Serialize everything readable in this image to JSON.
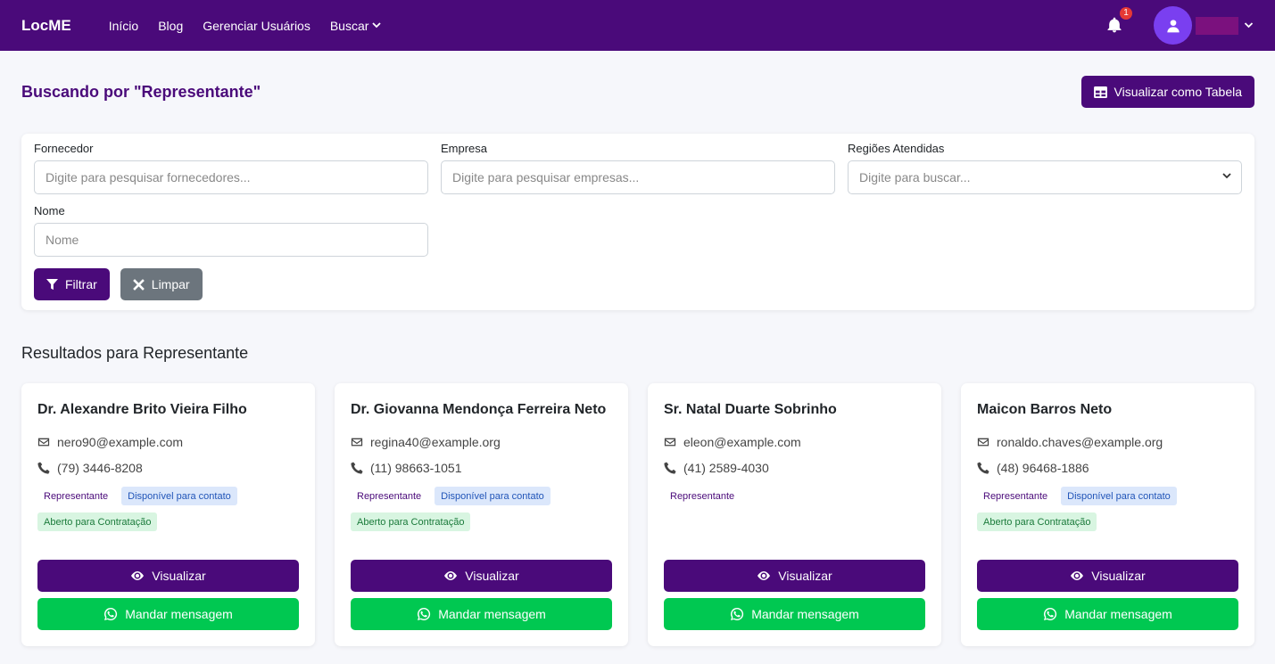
{
  "nav": {
    "brand": "LocME",
    "links": [
      "Início",
      "Blog",
      "Gerenciar Usuários",
      "Buscar"
    ],
    "notification_count": "1"
  },
  "header": {
    "title": "Buscando por \"Representante\"",
    "table_button": "Visualizar como Tabela"
  },
  "filters": {
    "fornecedor": {
      "label": "Fornecedor",
      "placeholder": "Digite para pesquisar fornecedores..."
    },
    "empresa": {
      "label": "Empresa",
      "placeholder": "Digite para pesquisar empresas..."
    },
    "regioes": {
      "label": "Regiões Atendidas",
      "placeholder": "Digite para buscar..."
    },
    "nome": {
      "label": "Nome",
      "placeholder": "Nome"
    },
    "filter_button": "Filtrar",
    "clear_button": "Limpar"
  },
  "results": {
    "title": "Resultados para Representante",
    "view_label": "Visualizar",
    "message_label": "Mandar mensagem",
    "cards": [
      {
        "name": "Dr. Alexandre Brito Vieira Filho",
        "email": "nero90@example.com",
        "phone": "(79) 3446-8208",
        "badges": [
          "Representante",
          "Disponível para contato",
          "Aberto para Contratação"
        ]
      },
      {
        "name": "Dr. Giovanna Mendonça Ferreira Neto",
        "email": "regina40@example.org",
        "phone": "(11) 98663-1051",
        "badges": [
          "Representante",
          "Disponível para contato",
          "Aberto para Contratação"
        ]
      },
      {
        "name": "Sr. Natal Duarte Sobrinho",
        "email": "eleon@example.com",
        "phone": "(41) 2589-4030",
        "badges": [
          "Representante"
        ]
      },
      {
        "name": "Maicon Barros Neto",
        "email": "ronaldo.chaves@example.org",
        "phone": "(48) 96468-1886",
        "badges": [
          "Representante",
          "Disponível para contato",
          "Aberto para Contratação"
        ]
      }
    ]
  }
}
